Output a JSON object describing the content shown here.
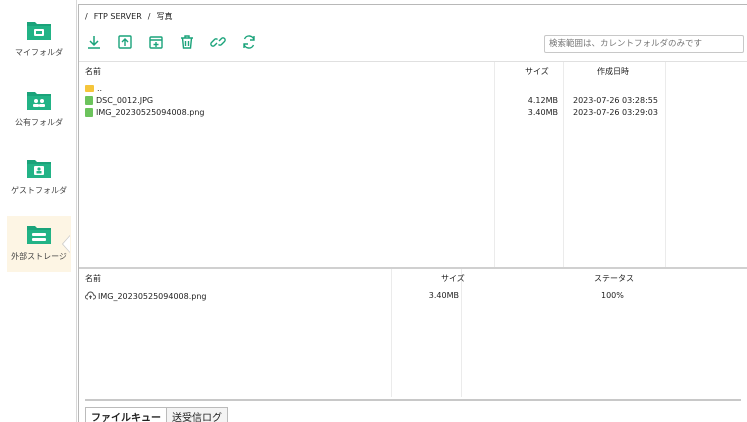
{
  "colors": {
    "accent": "#1aa37a",
    "active_bg": "#fdf5e4",
    "file_icon": "#6cc35c",
    "folder_icon": "#f5c53b"
  },
  "sidebar": {
    "items": [
      {
        "label": "マイフォルダ",
        "icon": "my-folder-icon"
      },
      {
        "label": "公有フォルダ",
        "icon": "public-folder-icon"
      },
      {
        "label": "ゲストフォルダ",
        "icon": "guest-folder-icon"
      },
      {
        "label": "外部ストレージ",
        "icon": "external-storage-icon",
        "active": true
      }
    ]
  },
  "breadcrumb": {
    "sep": "/",
    "root": "FTP SERVER",
    "sep2": "/",
    "current": "写真"
  },
  "toolbar": {
    "icons": [
      "download-icon",
      "upload-icon",
      "new-folder-icon",
      "delete-icon",
      "link-icon",
      "refresh-icon"
    ],
    "search_placeholder": "検索範囲は、カレントフォルダのみです"
  },
  "filelist": {
    "columns": {
      "name": "名前",
      "size": "サイズ",
      "date": "作成日時"
    },
    "rows": [
      {
        "name": "..",
        "size": "",
        "date": "",
        "type": "folder"
      },
      {
        "name": "DSC_0012.JPG",
        "size": "4.12MB",
        "date": "2023-07-26 03:28:55",
        "type": "file"
      },
      {
        "name": "IMG_20230525094008.png",
        "size": "3.40MB",
        "date": "2023-07-26 03:29:03",
        "type": "file"
      }
    ]
  },
  "queue": {
    "columns": {
      "name": "名前",
      "size": "サイズ",
      "status": "ステータス"
    },
    "rows": [
      {
        "name": "IMG_20230525094008.png",
        "size": "3.40MB",
        "status": "100%"
      }
    ]
  },
  "tabs": {
    "queue": "ファイルキュー",
    "log": "送受信ログ"
  }
}
